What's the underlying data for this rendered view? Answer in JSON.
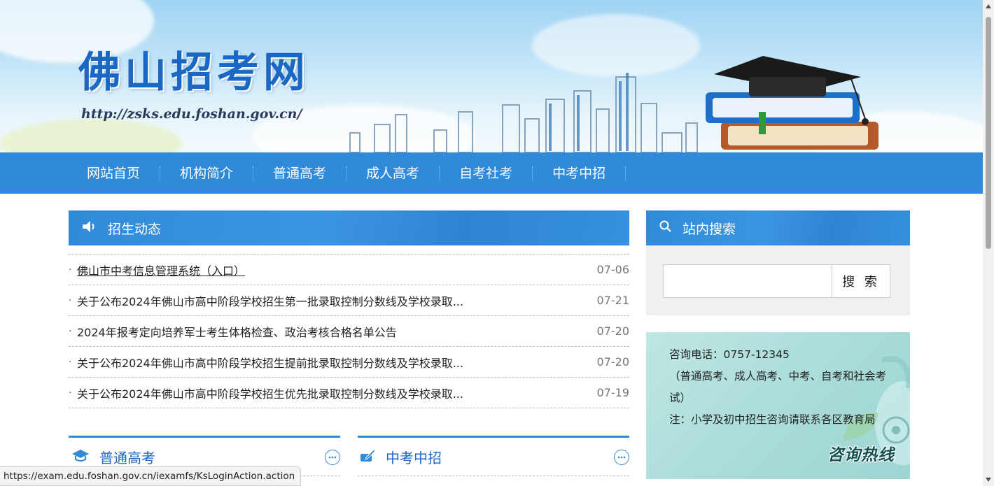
{
  "header": {
    "site_title": "佛山招考网",
    "site_url": "http://zsks.edu.foshan.gov.cn/"
  },
  "nav": {
    "items": [
      "网站首页",
      "机构简介",
      "普通高考",
      "成人高考",
      "自考社考",
      "中考中招"
    ]
  },
  "news": {
    "title": "招生动态",
    "items": [
      {
        "title": "佛山市中考信息管理系统（入口）",
        "date": "07-06"
      },
      {
        "title": "关于公布2024年佛山市高中阶段学校招生第一批录取控制分数线及学校录取...",
        "date": "07-21"
      },
      {
        "title": "2024年报考定向培养军士考生体格检查、政治考核合格名单公告",
        "date": "07-20"
      },
      {
        "title": "关于公布2024年佛山市高中阶段学校招生提前批录取控制分数线及学校录取...",
        "date": "07-20"
      },
      {
        "title": "关于公布2024年佛山市高中阶段学校招生优先批录取控制分数线及学校录取...",
        "date": "07-19"
      }
    ]
  },
  "sections": {
    "gaokao_title": "普通高考",
    "zhongkao_title": "中考中招"
  },
  "search": {
    "title": "站内搜索",
    "input_value": "",
    "button_label": "搜 索"
  },
  "hotline": {
    "phone_line": "咨询电话：0757-12345",
    "scope_line": "（普通高考、成人高考、中考、自考和社会考试）",
    "note_line": "注：小学及初中招生咨询请联系各区教育局",
    "badge": "咨询热线"
  },
  "status_bar": {
    "url": "https://exam.edu.foshan.gov.cn/iexamfs/KsLoginAction.action"
  },
  "colors": {
    "primary_blue": "#2f8ad9",
    "title_blue": "#1b67c4",
    "hotline_bg": "#a9dcd8"
  }
}
